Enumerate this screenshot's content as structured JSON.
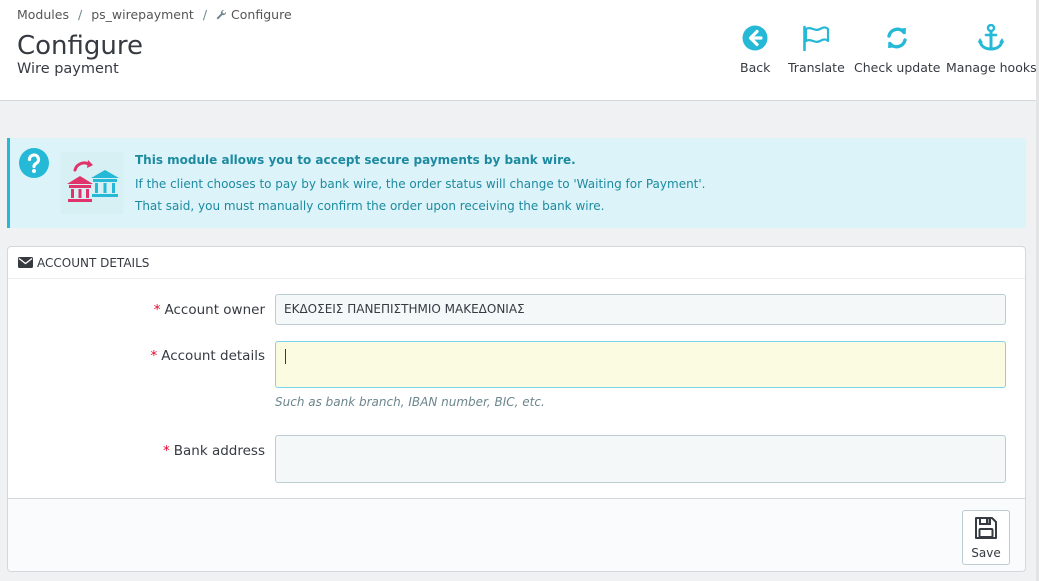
{
  "breadcrumb": {
    "items": [
      "Modules",
      "ps_wirepayment",
      "Configure"
    ],
    "separator": "/"
  },
  "header": {
    "title": "Configure",
    "subtitle": "Wire payment"
  },
  "toolbar": {
    "back": {
      "label": "Back",
      "icon": "arrow-left-circle-icon"
    },
    "translate": {
      "label": "Translate",
      "icon": "flag-icon"
    },
    "check_update": {
      "label": "Check update",
      "icon": "refresh-icon"
    },
    "manage_hooks": {
      "label": "Manage hooks",
      "icon": "anchor-icon"
    }
  },
  "info_alert": {
    "title": "This module allows you to accept secure payments by bank wire.",
    "line1": "If the client chooses to pay by bank wire, the order status will change to 'Waiting for Payment'.",
    "line2": "That said, you must manually confirm the order upon receiving the bank wire."
  },
  "panel": {
    "heading": "ACCOUNT DETAILS",
    "fields": {
      "owner": {
        "label": "Account owner",
        "value": "ΕΚΔΟΣΕΙΣ ΠΑΝΕΠΙΣΤΗΜΙΟ ΜΑΚΕΔΟΝΙΑΣ"
      },
      "details": {
        "label": "Account details",
        "value": "",
        "help": "Such as bank branch, IBAN number, BIC, etc."
      },
      "bank_address": {
        "label": "Bank address",
        "value": ""
      }
    },
    "required_mark": "*",
    "save_label": "Save"
  },
  "colors": {
    "accent": "#25b9d7",
    "required": "#e4002b",
    "alert_bg": "#dcf4f9",
    "alert_text": "#1e8aa0",
    "bank_icon": "#e0336b"
  }
}
